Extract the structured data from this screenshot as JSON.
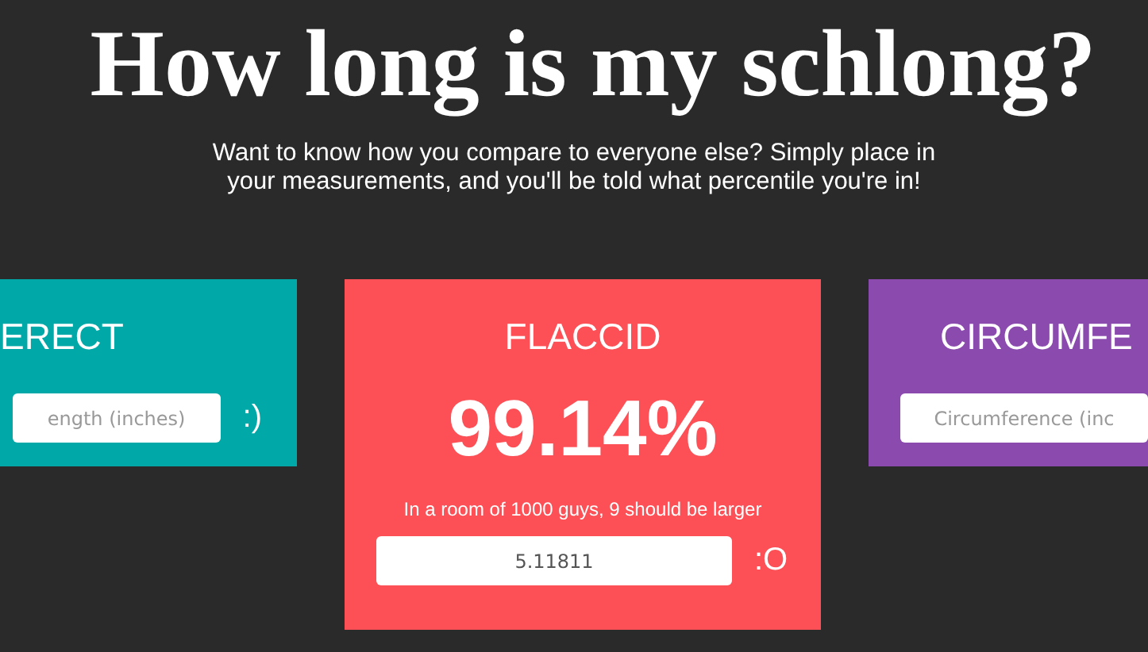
{
  "heading": "How long is my schlong?",
  "intro": "Want to know how you compare to everyone else? Simply place in your measurements, and you'll be told what percentile you're in!",
  "cards": [
    {
      "title": "ERECT",
      "color": "#00a8a8",
      "field": {
        "placeholder": "ength (inches)"
      },
      "face": ":)"
    },
    {
      "title": "FLACCID",
      "color": "#fd5056",
      "percentile": "99.14%",
      "note": "In a room of 1000 guys, 9 should be larger",
      "field": {
        "value": "5.11811"
      },
      "face": ":O"
    },
    {
      "title": "CIRCUMFE",
      "color": "#8a4aae",
      "field": {
        "placeholder": "Circumference (inc"
      }
    }
  ]
}
